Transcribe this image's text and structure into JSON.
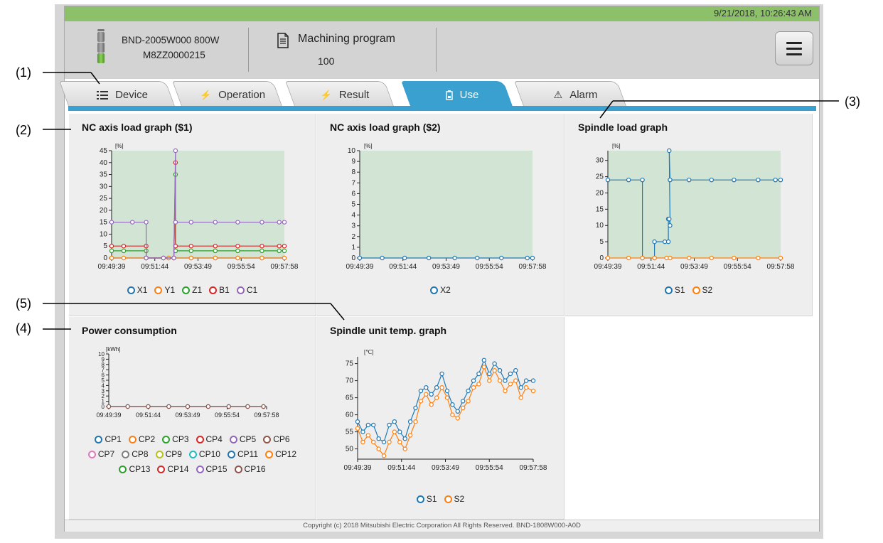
{
  "callouts": [
    "(1)",
    "(2)",
    "(3)",
    "(4)",
    "(5)"
  ],
  "status": {
    "datetime": "9/21/2018, 10:26:43 AM",
    "bar_color": "#8cc16a"
  },
  "device": {
    "model": "BND-2005W000 800W",
    "serial": "M8ZZ0000215",
    "icon": "signal-tower-icon"
  },
  "program": {
    "label": "Machining program",
    "number": "100",
    "icon": "document-icon"
  },
  "menu": {
    "icon": "hamburger-menu-icon"
  },
  "tabs": [
    {
      "label": "Device",
      "icon": "list-icon",
      "active": false
    },
    {
      "label": "Operation",
      "icon": "lightning-icon",
      "active": false
    },
    {
      "label": "Result",
      "icon": "lightning-icon",
      "active": false
    },
    {
      "label": "Use",
      "icon": "battery-icon",
      "active": true
    },
    {
      "label": "Alarm",
      "icon": "warning-icon",
      "active": false
    }
  ],
  "accent": "#3aa0cf",
  "panels": {
    "nc1": {
      "title": "NC axis load graph ($1)"
    },
    "nc2": {
      "title": "NC axis load graph ($2)"
    },
    "spindle": {
      "title": "Spindle load graph"
    },
    "power": {
      "title": "Power consumption"
    },
    "temp": {
      "title": "Spindle unit temp. graph"
    }
  },
  "chart_data": [
    {
      "id": "nc1",
      "type": "line",
      "title": "NC axis load graph ($1)",
      "ylabel": "[%]",
      "ylim": [
        0,
        45
      ],
      "yticks": [
        0,
        5,
        10,
        15,
        20,
        25,
        30,
        35,
        40,
        45
      ],
      "xticks": [
        "09:49:39",
        "09:51:44",
        "09:53:49",
        "09:55:54",
        "09:57:58"
      ],
      "plot_bg": "#d2e4d4",
      "series": [
        {
          "name": "X1",
          "color": "#1f77b4",
          "points": [
            [
              0,
              0
            ],
            [
              0.2,
              0
            ],
            [
              0.33,
              0
            ],
            [
              0.46,
              0
            ],
            [
              0.6,
              0
            ],
            [
              0.73,
              0
            ],
            [
              0.87,
              0
            ],
            [
              1,
              0
            ]
          ]
        },
        {
          "name": "Y1",
          "color": "#ff7f0e",
          "points": [
            [
              0,
              0
            ],
            [
              0.07,
              0
            ],
            [
              0.2,
              0
            ],
            [
              0.33,
              0
            ],
            [
              0.46,
              0
            ],
            [
              0.6,
              0
            ],
            [
              0.73,
              0
            ],
            [
              0.87,
              0
            ],
            [
              1,
              0
            ]
          ]
        },
        {
          "name": "Z1",
          "color": "#2ca02c",
          "points": [
            [
              0,
              3
            ],
            [
              0.07,
              3
            ],
            [
              0.2,
              3
            ],
            [
              0.2,
              0
            ],
            [
              0.3,
              0
            ],
            [
              0.36,
              0
            ],
            [
              0.37,
              35
            ],
            [
              0.37,
              3
            ],
            [
              0.46,
              3
            ],
            [
              0.6,
              3
            ],
            [
              0.73,
              3
            ],
            [
              0.87,
              3
            ],
            [
              0.97,
              3
            ],
            [
              1,
              3
            ]
          ]
        },
        {
          "name": "B1",
          "color": "#d62728",
          "points": [
            [
              0,
              5
            ],
            [
              0.07,
              5
            ],
            [
              0.2,
              5
            ],
            [
              0.2,
              0
            ],
            [
              0.3,
              0
            ],
            [
              0.36,
              0
            ],
            [
              0.37,
              40
            ],
            [
              0.37,
              5
            ],
            [
              0.46,
              5
            ],
            [
              0.6,
              5
            ],
            [
              0.73,
              5
            ],
            [
              0.87,
              5
            ],
            [
              0.97,
              5
            ],
            [
              1,
              5
            ]
          ]
        },
        {
          "name": "C1",
          "color": "#9467bd",
          "points": [
            [
              0,
              15
            ],
            [
              0.12,
              15
            ],
            [
              0.2,
              15
            ],
            [
              0.2,
              0
            ],
            [
              0.3,
              0
            ],
            [
              0.36,
              0
            ],
            [
              0.37,
              45
            ],
            [
              0.37,
              15
            ],
            [
              0.46,
              15
            ],
            [
              0.6,
              15
            ],
            [
              0.73,
              15
            ],
            [
              0.87,
              15
            ],
            [
              0.97,
              15
            ],
            [
              1,
              15
            ]
          ]
        }
      ]
    },
    {
      "id": "nc2",
      "type": "line",
      "title": "NC axis load graph ($2)",
      "ylabel": "[%]",
      "ylim": [
        0,
        10
      ],
      "yticks": [
        0,
        1,
        2,
        3,
        4,
        5,
        6,
        7,
        8,
        9,
        10
      ],
      "xticks": [
        "09:49:39",
        "09:51:44",
        "09:53:49",
        "09:55:54",
        "09:57:58"
      ],
      "plot_bg": "#d2e4d4",
      "series": [
        {
          "name": "X2",
          "color": "#1f77b4",
          "points": [
            [
              0,
              0
            ],
            [
              0.13,
              0
            ],
            [
              0.26,
              0
            ],
            [
              0.4,
              0
            ],
            [
              0.55,
              0
            ],
            [
              0.68,
              0
            ],
            [
              0.82,
              0
            ],
            [
              0.97,
              0
            ],
            [
              1,
              0
            ]
          ]
        }
      ]
    },
    {
      "id": "spindle",
      "type": "line",
      "title": "Spindle load graph",
      "ylabel": "[%]",
      "ylim": [
        0,
        33
      ],
      "yticks": [
        0,
        5,
        10,
        15,
        20,
        25,
        30
      ],
      "xticks": [
        "09:49:39",
        "09:51:44",
        "09:53:49",
        "09:55:54",
        "09:57:58"
      ],
      "plot_bg": "#d2e4d4",
      "series": [
        {
          "name": "S1",
          "color": "#1f77b4",
          "points": [
            [
              0,
              24
            ],
            [
              0.12,
              24
            ],
            [
              0.2,
              24
            ],
            [
              0.2,
              0
            ],
            [
              0.27,
              0
            ],
            [
              0.27,
              5
            ],
            [
              0.33,
              5
            ],
            [
              0.35,
              5
            ],
            [
              0.35,
              12
            ],
            [
              0.355,
              12
            ],
            [
              0.36,
              10
            ],
            [
              0.355,
              33
            ],
            [
              0.36,
              24
            ],
            [
              0.47,
              24
            ],
            [
              0.6,
              24
            ],
            [
              0.73,
              24
            ],
            [
              0.87,
              24
            ],
            [
              0.97,
              24
            ],
            [
              1,
              24
            ]
          ]
        },
        {
          "name": "S2",
          "color": "#ff7f0e",
          "points": [
            [
              0,
              0
            ],
            [
              0.12,
              0
            ],
            [
              0.2,
              0
            ],
            [
              0.27,
              0
            ],
            [
              0.34,
              0
            ],
            [
              0.36,
              0
            ],
            [
              0.47,
              0
            ],
            [
              0.6,
              0
            ],
            [
              0.73,
              0
            ],
            [
              0.87,
              0
            ],
            [
              1,
              0
            ]
          ]
        }
      ]
    },
    {
      "id": "power",
      "type": "line",
      "title": "Power consumption",
      "ylabel": "[kWh]",
      "ylim": [
        0,
        10
      ],
      "yticks": [
        0,
        1,
        2,
        3,
        4,
        5,
        6,
        7,
        8,
        9,
        10
      ],
      "xticks": [
        "09:49:39",
        "09:51:44",
        "09:53:49",
        "09:55:54",
        "09:57:58"
      ],
      "plot_bg": "none",
      "series": [
        {
          "name": "CP1",
          "color": "#1f77b4",
          "points": [
            [
              0,
              0
            ],
            [
              0.12,
              0
            ],
            [
              0.25,
              0
            ],
            [
              0.38,
              0
            ],
            [
              0.5,
              0
            ],
            [
              0.63,
              0
            ],
            [
              0.76,
              0
            ],
            [
              0.88,
              0
            ],
            [
              0.98,
              0
            ]
          ]
        },
        {
          "name": "CP2",
          "color": "#ff7f0e",
          "points": []
        },
        {
          "name": "CP3",
          "color": "#2ca02c",
          "points": []
        },
        {
          "name": "CP4",
          "color": "#d62728",
          "points": []
        },
        {
          "name": "CP5",
          "color": "#9467bd",
          "points": []
        },
        {
          "name": "CP6",
          "color": "#8c564b",
          "points": []
        },
        {
          "name": "CP7",
          "color": "#e377c2",
          "points": []
        },
        {
          "name": "CP8",
          "color": "#7f7f7f",
          "points": []
        },
        {
          "name": "CP9",
          "color": "#bcbd22",
          "points": []
        },
        {
          "name": "CP10",
          "color": "#17becf",
          "points": []
        },
        {
          "name": "CP11",
          "color": "#1f77b4",
          "points": []
        },
        {
          "name": "CP12",
          "color": "#ff7f0e",
          "points": []
        },
        {
          "name": "CP13",
          "color": "#2ca02c",
          "points": []
        },
        {
          "name": "CP14",
          "color": "#d62728",
          "points": []
        },
        {
          "name": "CP15",
          "color": "#9467bd",
          "points": []
        },
        {
          "name": "CP16",
          "color": "#8c564b",
          "points": [
            [
              0,
              0
            ],
            [
              0.12,
              0
            ],
            [
              0.25,
              0
            ],
            [
              0.38,
              0
            ],
            [
              0.5,
              0
            ],
            [
              0.63,
              0
            ],
            [
              0.76,
              0
            ],
            [
              0.88,
              0
            ],
            [
              0.98,
              0
            ]
          ]
        }
      ]
    },
    {
      "id": "temp",
      "type": "line",
      "title": "Spindle unit temp. graph",
      "ylabel": "[℃]",
      "ylim": [
        47,
        77
      ],
      "yticks": [
        50,
        55,
        60,
        65,
        70,
        75
      ],
      "xticks": [
        "09:49:39",
        "09:51:44",
        "09:53:49",
        "09:55:54",
        "09:57:58"
      ],
      "plot_bg": "none",
      "series": [
        {
          "name": "S1",
          "color": "#1f77b4",
          "points": [
            [
              0,
              58
            ],
            [
              0.03,
              55
            ],
            [
              0.06,
              57
            ],
            [
              0.09,
              57
            ],
            [
              0.12,
              53
            ],
            [
              0.15,
              52
            ],
            [
              0.18,
              57
            ],
            [
              0.21,
              58
            ],
            [
              0.24,
              55
            ],
            [
              0.27,
              53
            ],
            [
              0.3,
              58
            ],
            [
              0.33,
              62
            ],
            [
              0.36,
              67
            ],
            [
              0.39,
              68
            ],
            [
              0.42,
              66
            ],
            [
              0.45,
              68
            ],
            [
              0.48,
              72
            ],
            [
              0.51,
              67
            ],
            [
              0.54,
              63
            ],
            [
              0.57,
              61
            ],
            [
              0.6,
              64
            ],
            [
              0.63,
              67
            ],
            [
              0.66,
              70
            ],
            [
              0.69,
              72
            ],
            [
              0.72,
              76
            ],
            [
              0.75,
              72
            ],
            [
              0.78,
              75
            ],
            [
              0.81,
              73
            ],
            [
              0.84,
              70
            ],
            [
              0.87,
              72
            ],
            [
              0.9,
              73
            ],
            [
              0.93,
              68
            ],
            [
              0.96,
              70
            ],
            [
              1,
              70
            ]
          ]
        },
        {
          "name": "S2",
          "color": "#ff7f0e",
          "points": [
            [
              0,
              56
            ],
            [
              0.03,
              52
            ],
            [
              0.06,
              54
            ],
            [
              0.09,
              52
            ],
            [
              0.12,
              50
            ],
            [
              0.15,
              48
            ],
            [
              0.18,
              52
            ],
            [
              0.21,
              55
            ],
            [
              0.24,
              52
            ],
            [
              0.27,
              50
            ],
            [
              0.3,
              54
            ],
            [
              0.33,
              58
            ],
            [
              0.36,
              64
            ],
            [
              0.39,
              66
            ],
            [
              0.42,
              63
            ],
            [
              0.45,
              65
            ],
            [
              0.48,
              68
            ],
            [
              0.51,
              65
            ],
            [
              0.54,
              60
            ],
            [
              0.57,
              59
            ],
            [
              0.6,
              62
            ],
            [
              0.63,
              64
            ],
            [
              0.66,
              68
            ],
            [
              0.69,
              69
            ],
            [
              0.72,
              74
            ],
            [
              0.75,
              70
            ],
            [
              0.78,
              73
            ],
            [
              0.81,
              70
            ],
            [
              0.84,
              67
            ],
            [
              0.87,
              69
            ],
            [
              0.9,
              70
            ],
            [
              0.93,
              65
            ],
            [
              0.96,
              68
            ],
            [
              1,
              67
            ]
          ]
        }
      ]
    }
  ],
  "footer": "Copyright (c) 2018 Mitsubishi Electric Corporation All Rights Reserved. BND-1808W000-A0D"
}
